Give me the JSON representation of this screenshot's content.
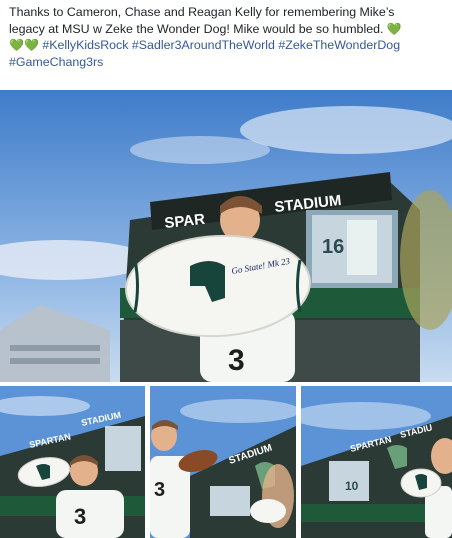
{
  "post": {
    "text_line1": "Thanks to Cameron, Chase and Reagan Kelly for remembering Mike’s",
    "text_line2": "legacy at MSU w Zeke the Wonder Dog! Mike would be so humbled.",
    "heart1": "💚",
    "heart2": "💚",
    "heart3": "💚",
    "hashtags": [
      "#KellyKidsRock",
      "#Sadler3AroundTheWorld",
      "#ZekeTheWonderDog",
      "#GameChang3rs"
    ]
  },
  "photos": {
    "main": {
      "stadium_sign": "SPARTAN STADIUM",
      "sign_left": "SPAR",
      "sign_right": "STADIUM",
      "autograph": "Go State! Mk 23",
      "screen_number": "16"
    },
    "thumb1": {
      "stadium_sign": "SPARTAN STADIUM",
      "sign_a": "SPARTAN",
      "sign_b": "STADIUM",
      "jersey_number": "3"
    },
    "thumb2": {
      "sign": "STADIUM",
      "jersey_number": "3"
    },
    "thumb3": {
      "sign_a": "SPARTAN",
      "sign_b": "STADIU",
      "screen_number": "10"
    }
  },
  "colors": {
    "hashtag": "#365899",
    "heart": "#58c322",
    "spartan_green": "#18453b",
    "sky": "#6f9fd8"
  }
}
